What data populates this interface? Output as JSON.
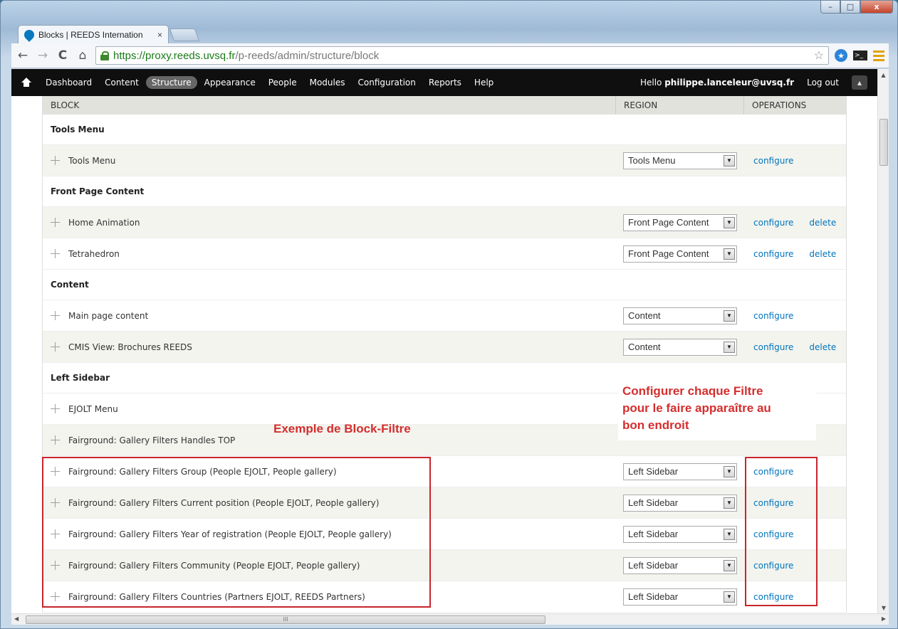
{
  "browser": {
    "tab_title": "Blocks | REEDS Internation",
    "tab_close": "×",
    "url_scheme_host": "https://proxy.reeds.uvsq.fr",
    "url_path": "/p-reeds/admin/structure/block",
    "window_controls": {
      "minimize": "–",
      "maximize": "□",
      "close": "x"
    },
    "nav": {
      "back": "←",
      "forward": "→",
      "reload": "C",
      "home": "⌂"
    },
    "bookmark_star": "☆"
  },
  "admin_bar": {
    "items": [
      {
        "label": "Dashboard",
        "active": false
      },
      {
        "label": "Content",
        "active": false
      },
      {
        "label": "Structure",
        "active": true
      },
      {
        "label": "Appearance",
        "active": false
      },
      {
        "label": "People",
        "active": false
      },
      {
        "label": "Modules",
        "active": false
      },
      {
        "label": "Configuration",
        "active": false
      },
      {
        "label": "Reports",
        "active": false
      },
      {
        "label": "Help",
        "active": false
      }
    ],
    "hello_prefix": "Hello ",
    "user": "philippe.lanceleur@uvsq.fr",
    "logout": "Log out",
    "shortcut_toggle": "▲"
  },
  "table": {
    "headers": {
      "block": "BLOCK",
      "region": "REGION",
      "operations": "OPERATIONS"
    },
    "sections": [
      {
        "title": "Tools Menu",
        "rows": [
          {
            "name": "Tools Menu",
            "region": "Tools Menu",
            "configure": "configure",
            "delete": ""
          }
        ]
      },
      {
        "title": "Front Page Content",
        "rows": [
          {
            "name": "Home Animation",
            "region": "Front Page Content",
            "configure": "configure",
            "delete": "delete"
          },
          {
            "name": "Tetrahedron",
            "region": "Front Page Content",
            "configure": "configure",
            "delete": "delete"
          }
        ]
      },
      {
        "title": "Content",
        "rows": [
          {
            "name": "Main page content",
            "region": "Content",
            "configure": "configure",
            "delete": ""
          },
          {
            "name": "CMIS View: Brochures REEDS",
            "region": "Content",
            "configure": "configure",
            "delete": "delete"
          }
        ]
      },
      {
        "title": "Left Sidebar",
        "rows": [
          {
            "name": "EJOLT Menu",
            "region": "",
            "configure": "",
            "delete": ""
          },
          {
            "name": "Fairground: Gallery Filters Handles TOP",
            "region": "",
            "configure": "",
            "delete": ""
          },
          {
            "name": "Fairground: Gallery Filters Group (People EJOLT, People gallery)",
            "region": "Left Sidebar",
            "configure": "configure",
            "delete": ""
          },
          {
            "name": "Fairground: Gallery Filters Current position (People EJOLT, People gallery)",
            "region": "Left Sidebar",
            "configure": "configure",
            "delete": ""
          },
          {
            "name": "Fairground: Gallery Filters Year of registration (People EJOLT, People gallery)",
            "region": "Left Sidebar",
            "configure": "configure",
            "delete": ""
          },
          {
            "name": "Fairground: Gallery Filters Community (People EJOLT, People gallery)",
            "region": "Left Sidebar",
            "configure": "configure",
            "delete": ""
          },
          {
            "name": "Fairground: Gallery Filters Countries (Partners EJOLT, REEDS Partners)",
            "region": "Left Sidebar",
            "configure": "configure",
            "delete": ""
          }
        ]
      }
    ],
    "select_arrow": "▼",
    "drag_handle": "drag-handle"
  },
  "annotations": {
    "block_filter": "Exemple de Block-Filtre",
    "configure_note": [
      "Configurer chaque Filtre",
      "pour le faire apparaître au",
      "bon endroit"
    ],
    "color": "#d42e2e"
  },
  "scrollbar": {
    "h_grip": "III"
  }
}
